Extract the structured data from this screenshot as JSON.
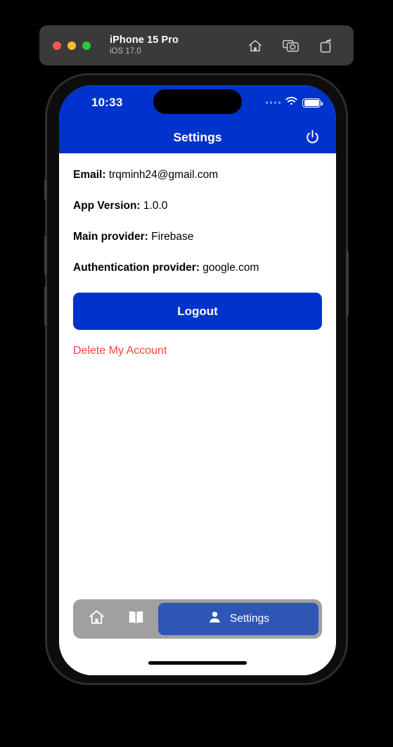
{
  "simulator": {
    "device": "iPhone 15 Pro",
    "os": "iOS 17.0",
    "window_controls": [
      "close",
      "minimize",
      "maximize"
    ],
    "toolbar_icons": [
      "home-icon",
      "screenshot-camera-icon",
      "rotate-icon"
    ]
  },
  "status_bar": {
    "time": "10:33",
    "signal": "signal-dots-icon",
    "wifi": "wifi-icon",
    "battery": "battery-icon"
  },
  "navbar": {
    "title": "Settings",
    "power_icon": "power-icon"
  },
  "content": {
    "rows": [
      {
        "label": "Email:",
        "value": "trqminh24@gmail.com"
      },
      {
        "label": "App Version:",
        "value": "1.0.0"
      },
      {
        "label": "Main provider:",
        "value": "Firebase"
      },
      {
        "label": "Authentication provider:",
        "value": "google.com"
      }
    ],
    "logout_label": "Logout",
    "delete_label": "Delete My Account"
  },
  "tabbar": {
    "tabs": [
      {
        "icon": "home-icon",
        "label": "",
        "active": false
      },
      {
        "icon": "book-icon",
        "label": "",
        "active": false
      },
      {
        "icon": "person-icon",
        "label": "Settings",
        "active": true
      }
    ]
  },
  "colors": {
    "primary_blue": "#0033CC",
    "active_tab_blue": "#2F55B5",
    "tabbar_gray": "#A0A0A0",
    "danger_red": "#F9453A",
    "sim_bar_gray": "#3A3A3A"
  }
}
